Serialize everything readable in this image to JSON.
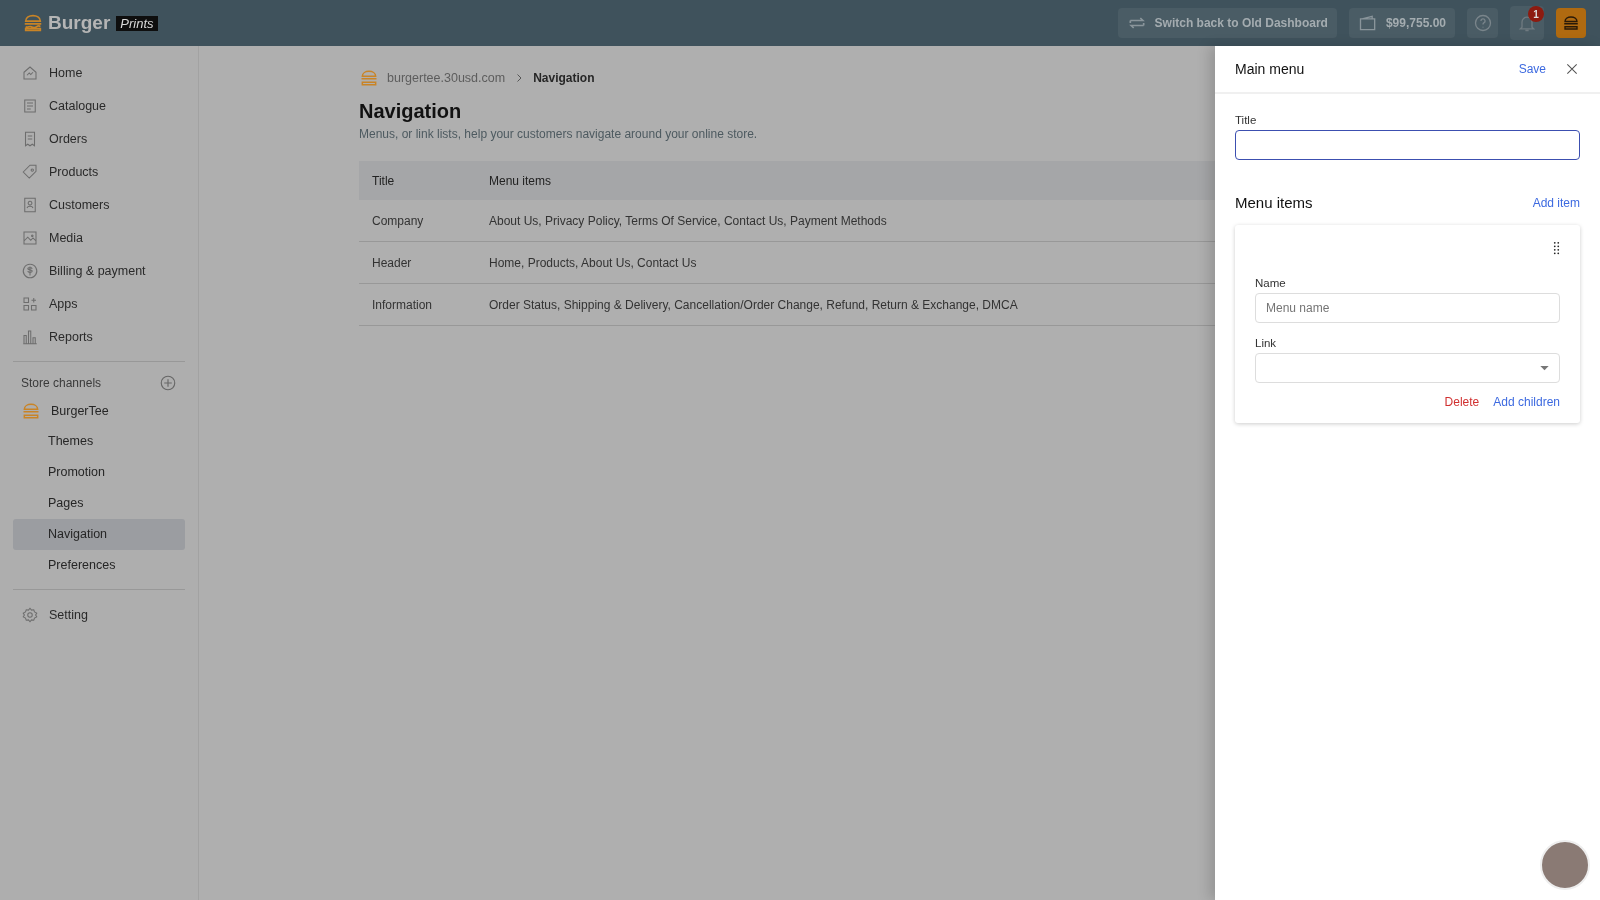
{
  "header": {
    "brand": "Burger",
    "brand_tag": "Prints",
    "switch_button": "Switch back to Old Dashboard",
    "balance": "$99,755.00",
    "notification_count": "1"
  },
  "sidebar": {
    "items": [
      {
        "label": "Home",
        "selected": false
      },
      {
        "label": "Catalogue",
        "selected": false
      },
      {
        "label": "Orders",
        "selected": false
      },
      {
        "label": "Products",
        "selected": false
      },
      {
        "label": "Customers",
        "selected": false
      },
      {
        "label": "Media",
        "selected": false
      },
      {
        "label": "Billing & payment",
        "selected": false
      },
      {
        "label": "Apps",
        "selected": false
      },
      {
        "label": "Reports",
        "selected": false
      }
    ],
    "store_channels": {
      "label": "Store channels",
      "store": "BurgerTee",
      "items": [
        {
          "label": "Themes",
          "selected": false
        },
        {
          "label": "Promotion",
          "selected": false
        },
        {
          "label": "Pages",
          "selected": false
        },
        {
          "label": "Navigation",
          "selected": true
        },
        {
          "label": "Preferences",
          "selected": false
        }
      ]
    },
    "setting": "Setting"
  },
  "breadcrumb": {
    "store": "burgertee.30usd.com",
    "current": "Navigation"
  },
  "page": {
    "title": "Navigation",
    "description": "Menus, or link lists, help your customers navigate around your online store."
  },
  "table": {
    "columns": [
      "Title",
      "Menu items"
    ],
    "rows": [
      [
        "Company",
        "About Us, Privacy Policy, Terms Of Service, Contact Us, Payment Methods"
      ],
      [
        "Header",
        "Home, Products, About Us, Contact Us"
      ],
      [
        "Information",
        "Order Status, Shipping & Delivery, Cancellation/Order Change, Refund, Return & Exchange, DMCA"
      ]
    ]
  },
  "drawer": {
    "title": "Main menu",
    "save": "Save",
    "title_label": "Title",
    "title_focused": true,
    "menu_items_heading": "Menu items",
    "add_item": "Add item",
    "item": {
      "name_label": "Name",
      "name_placeholder": "Menu name",
      "link_label": "Link",
      "delete": "Delete",
      "add_children": "Add children"
    }
  }
}
